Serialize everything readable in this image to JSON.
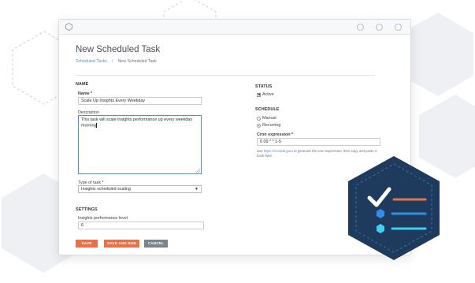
{
  "page": {
    "title": "New Scheduled Task",
    "breadcrumb": {
      "parent": "Scheduled Tasks",
      "current": "New Scheduled Task"
    }
  },
  "name_section": {
    "heading": "NAME",
    "name_label": "Name *",
    "name_value": "Scale Up Insights Every Weekday",
    "description_label": "Description",
    "description_value": "This task will scale insights performance up every weekday morning",
    "type_label": "Type of task *",
    "type_value": "Insights scheduled scaling"
  },
  "settings_section": {
    "heading": "SETTINGS",
    "perf_label": "Insights performance level",
    "perf_value": "6"
  },
  "status_section": {
    "heading": "STATUS",
    "active_label": "Active",
    "active_checked": true
  },
  "schedule_section": {
    "heading": "SCHEDULE",
    "options": [
      {
        "label": "Manual",
        "selected": false
      },
      {
        "label": "Recurring",
        "selected": true
      }
    ],
    "cron_label": "Cron expression *",
    "cron_value": "0 09 * * 1-5",
    "hint_prefix": "Use",
    "hint_link": "https://crontab.guru",
    "hint_suffix": "to generate the cron expression, then copy and paste it back here."
  },
  "buttons": {
    "save": "SAVE",
    "save_and_run": "SAVE AND RUN",
    "cancel": "CANCEL"
  },
  "colors": {
    "accent_orange": "#e5734a",
    "cancel_gray": "#7b838d",
    "badge_navy": "#1e3a5c",
    "badge_check": "#ffffff",
    "badge_item_orange": "#e5734a",
    "badge_item_blue": "#2f8fe8",
    "badge_item_cyan": "#3ed0f0"
  },
  "icons": [
    "hexagon-icon",
    "checklist-badge-icon"
  ]
}
